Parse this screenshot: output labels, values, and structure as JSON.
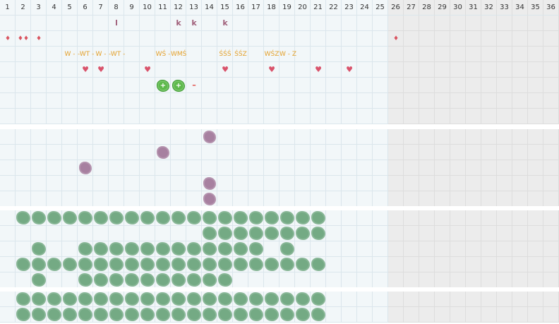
{
  "columns": [
    "1",
    "2",
    "3",
    "4",
    "5",
    "6",
    "7",
    "8",
    "9",
    "10",
    "11",
    "12",
    "13",
    "14",
    "15",
    "16",
    "17",
    "18",
    "19",
    "20",
    "21",
    "22",
    "23",
    "24",
    "25",
    "26",
    "27",
    "28",
    "29",
    "30",
    "31",
    "32",
    "33",
    "34",
    "35",
    "36"
  ],
  "shaded_from_column": 26,
  "sections": [
    {
      "name": "section-1",
      "rows": 7
    },
    {
      "name": "section-2",
      "rows": 5
    },
    {
      "name": "section-3",
      "rows": 5
    },
    {
      "name": "section-4",
      "rows": 2
    }
  ],
  "colors": {
    "letter": "#a0607a",
    "drop": "#d9535f",
    "heart": "#d9536b",
    "wstring": "#e3a02a",
    "green_blob": "#74aa84",
    "purple_blob": "#a780a0",
    "bright_green": "#5cb94a",
    "shaded_cell": "#ececec"
  },
  "section1_marks": [
    {
      "type": "letter",
      "text": "l",
      "row": 0,
      "col": 8
    },
    {
      "type": "letter",
      "text": "k",
      "row": 0,
      "col": 12
    },
    {
      "type": "letter",
      "text": "k",
      "row": 0,
      "col": 13
    },
    {
      "type": "letter",
      "text": "k",
      "row": 0,
      "col": 15
    },
    {
      "type": "drop",
      "text": "♦",
      "row": 1,
      "col": 1
    },
    {
      "type": "drop",
      "text": "♦♦",
      "row": 1,
      "col": 2
    },
    {
      "type": "drop",
      "text": "♦",
      "row": 1,
      "col": 3
    },
    {
      "type": "drop",
      "text": "♦",
      "row": 1,
      "col": 26
    },
    {
      "type": "wstr",
      "text": "W -",
      "row": 2,
      "col": 5
    },
    {
      "type": "wstr",
      "text": "-WT -",
      "row": 2,
      "col": 6
    },
    {
      "type": "wstr",
      "text": "W -",
      "row": 2,
      "col": 7
    },
    {
      "type": "wstr",
      "text": "-WT -",
      "row": 2,
      "col": 8
    },
    {
      "type": "wstr",
      "text": "WŚ -",
      "row": 2,
      "col": 11
    },
    {
      "type": "wstr",
      "text": "WMŚ",
      "row": 2,
      "col": 12
    },
    {
      "type": "wstr",
      "text": "ŚŚŚ",
      "row": 2,
      "col": 15
    },
    {
      "type": "wstr",
      "text": "ŚŚZ",
      "row": 2,
      "col": 16
    },
    {
      "type": "wstr",
      "text": "WŚZ",
      "row": 2,
      "col": 18
    },
    {
      "type": "wstr",
      "text": "W - Z",
      "row": 2,
      "col": 19
    },
    {
      "type": "heart",
      "text": "♥",
      "row": 3,
      "col": 6
    },
    {
      "type": "heart",
      "text": "♥",
      "row": 3,
      "col": 7
    },
    {
      "type": "heart",
      "text": "♥",
      "row": 3,
      "col": 10
    },
    {
      "type": "heart",
      "text": "♥",
      "row": 3,
      "col": 15
    },
    {
      "type": "heart",
      "text": "♥",
      "row": 3,
      "col": 18
    },
    {
      "type": "heart",
      "text": "♥",
      "row": 3,
      "col": 21
    },
    {
      "type": "heart",
      "text": "♥",
      "row": 3,
      "col": 23
    },
    {
      "type": "bright",
      "text": "+",
      "row": 4,
      "col": 11
    },
    {
      "type": "bright",
      "text": "+",
      "row": 4,
      "col": 12
    },
    {
      "type": "minus",
      "text": "–",
      "row": 4,
      "col": 13
    }
  ],
  "section2_purple": [
    {
      "row": 0,
      "col": 14
    },
    {
      "row": 1,
      "col": 11
    },
    {
      "row": 2,
      "col": 6
    },
    {
      "row": 3,
      "col": 14
    },
    {
      "row": 4,
      "col": 14
    }
  ],
  "section3_green_rows": [
    [
      2,
      3,
      4,
      5,
      6,
      7,
      8,
      9,
      10,
      11,
      12,
      13,
      14,
      15,
      16,
      17,
      18,
      19,
      20,
      21
    ],
    [
      14,
      15,
      16,
      17,
      18,
      19,
      20,
      21
    ],
    [
      3,
      6,
      7,
      8,
      9,
      10,
      11,
      12,
      13,
      14,
      15,
      16,
      17,
      19
    ],
    [
      2,
      3,
      4,
      5,
      6,
      7,
      8,
      9,
      10,
      11,
      12,
      13,
      14,
      15,
      16,
      17,
      18,
      19,
      20,
      21
    ],
    [
      3,
      6,
      7,
      8,
      9,
      10,
      11,
      12,
      13,
      14,
      15
    ]
  ],
  "section4_green_rows": [
    [
      2,
      3,
      4,
      5,
      6,
      7,
      8,
      9,
      10,
      11,
      12,
      13,
      14,
      15,
      16,
      17,
      18,
      19,
      20,
      21
    ],
    [
      2,
      3,
      4,
      5,
      6,
      7,
      8,
      9,
      10,
      11,
      12,
      13,
      14,
      15,
      16,
      17,
      18,
      19,
      20,
      21
    ]
  ]
}
